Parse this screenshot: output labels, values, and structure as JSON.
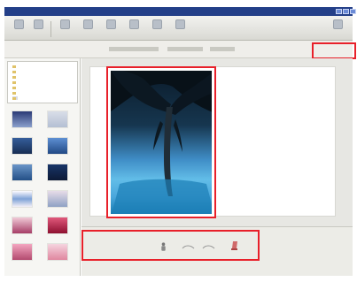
{
  "window": {
    "title": "",
    "controls": [
      "minimize",
      "maximize",
      "close"
    ]
  },
  "toolbar": {
    "buttons": [
      {
        "label": "",
        "icon": "back-icon"
      },
      {
        "label": "",
        "icon": "forward-icon"
      },
      {
        "label": "",
        "icon": "folder-icon"
      },
      {
        "label": "",
        "icon": "view-icon"
      },
      {
        "label": "",
        "icon": "rotate-icon"
      },
      {
        "label": "",
        "icon": "print-icon"
      },
      {
        "label": "",
        "icon": "edit-icon"
      },
      {
        "label": "",
        "icon": "share-icon"
      },
      {
        "label": "",
        "icon": "settings-icon"
      }
    ]
  },
  "subbar": {
    "left_text": "",
    "right_text": ""
  },
  "tree": {
    "items": [
      {
        "label": "",
        "selected": false
      },
      {
        "label": "",
        "selected": false
      },
      {
        "label": "",
        "selected": false
      },
      {
        "label": "",
        "selected": false
      },
      {
        "label": "",
        "selected": false
      },
      {
        "label": "",
        "selected": false
      },
      {
        "label": "",
        "selected": true
      }
    ]
  },
  "thumbnails": [
    {
      "caption": ""
    },
    {
      "caption": ""
    },
    {
      "caption": ""
    },
    {
      "caption": ""
    },
    {
      "caption": ""
    },
    {
      "caption": ""
    },
    {
      "caption": ""
    },
    {
      "caption": ""
    },
    {
      "caption": ""
    },
    {
      "caption": ""
    },
    {
      "caption": ""
    },
    {
      "caption": ""
    }
  ],
  "bottom": {
    "caption": ""
  },
  "colors": {
    "highlight": "#e8202a",
    "titlebar": "#233f88",
    "panel": "#f6f6f3"
  }
}
